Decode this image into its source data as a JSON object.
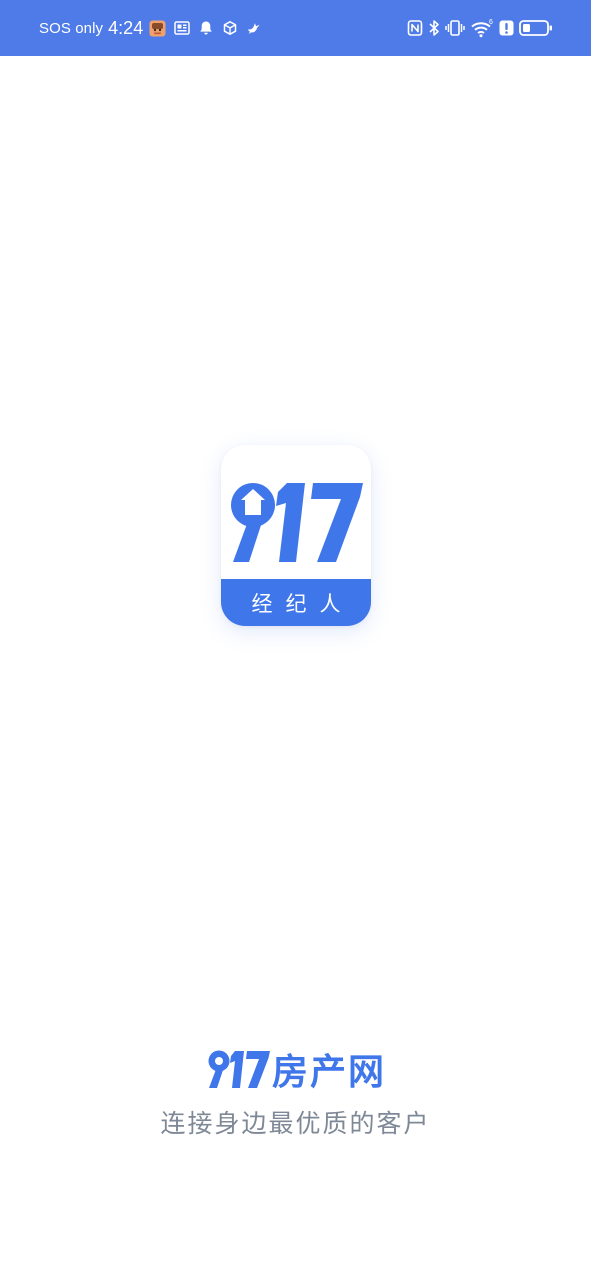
{
  "status_bar": {
    "carrier_text": "SOS only",
    "time": "4:24",
    "background_color": "#4f7be9",
    "left_icons": [
      "app-avatar-icon",
      "qr-card-icon",
      "bell-icon",
      "package-icon",
      "bird-icon"
    ],
    "right_icons": [
      "nfc-icon",
      "bluetooth-icon",
      "vibrate-icon",
      "wifi-icon",
      "alert-icon",
      "battery-icon"
    ],
    "wifi_generation": "6",
    "battery_level_fraction": 0.3
  },
  "app_logo": {
    "number": "917",
    "band_text": "经纪人",
    "accent_color": "#3f76ea"
  },
  "brand": {
    "number": "917",
    "name": "房产网",
    "slogan": "连接身边最优质的客户"
  }
}
